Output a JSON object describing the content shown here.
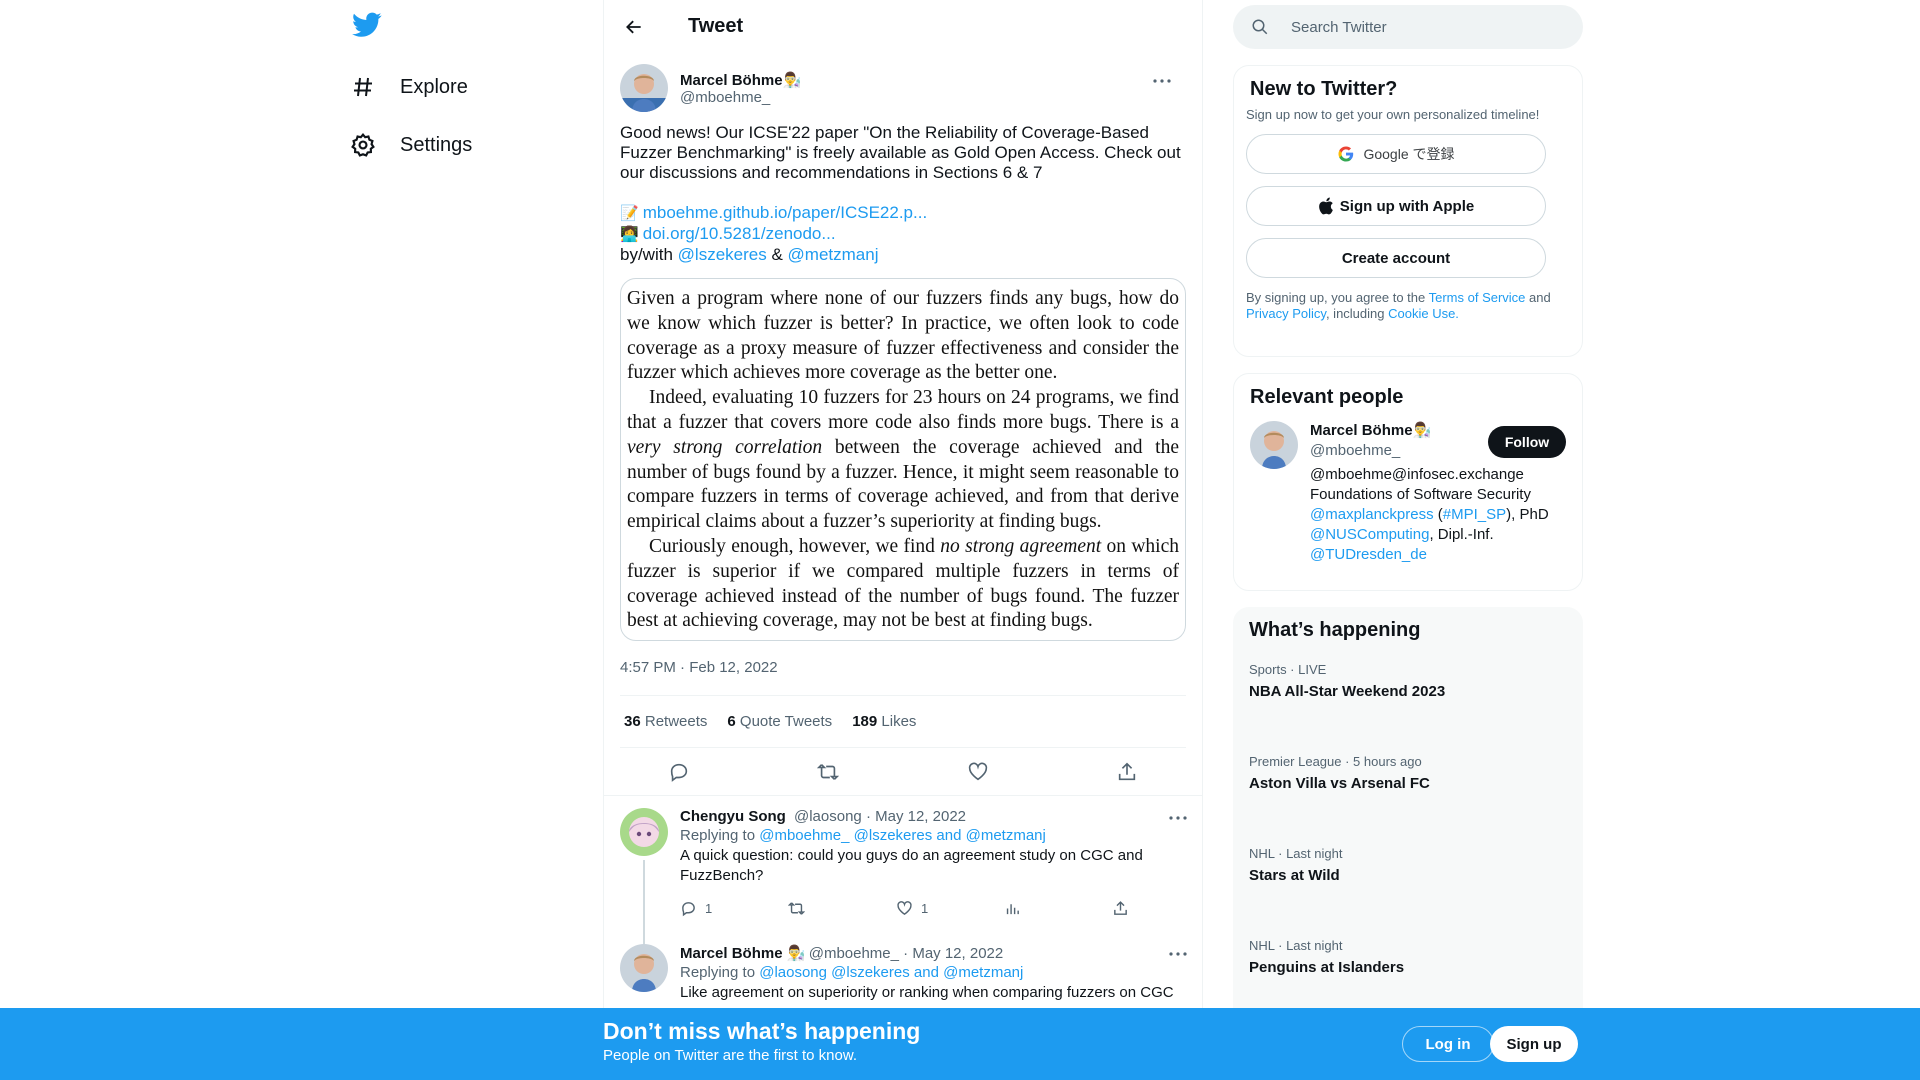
{
  "nav": {
    "items": [
      {
        "label": "Explore",
        "icon": "hashtag-icon"
      },
      {
        "label": "Settings",
        "icon": "gear-icon"
      }
    ]
  },
  "header": {
    "title": "Tweet"
  },
  "tweet": {
    "author_name": "Marcel Böhme",
    "author_emoji": "👨‍🔬",
    "author_handle": "@mboehme_",
    "text": "Good news! Our ICSE'22 paper \"On the Reliability of Coverage-Based Fuzzer Benchmarking\" is freely available as Gold Open Access. Check out our discussions and recommendations in Sections 6 & 7",
    "link1_emoji": "📝",
    "link1": "mboehme.github.io/paper/ICSE22.p...",
    "link2_emoji": "👩‍💻",
    "link2": "doi.org/10.5281/zenodo...",
    "bywith_prefix": "by/with",
    "mention1": "@lszekeres",
    "amp": "&",
    "mention2": "@metzmanj",
    "paper": {
      "p1": "Given a program where none of our fuzzers finds any bugs, how do we know which fuzzer is better? In practice, we often look to code coverage as a proxy measure of fuzzer effectiveness and consider the fuzzer which achieves more coverage as the better one.",
      "p2a": "Indeed, evaluating 10 fuzzers for 23 hours on 24 programs, we find that a fuzzer that covers more code also finds more bugs. There is a ",
      "p2em": "very strong correlation",
      "p2b": " between the coverage achieved and the number of bugs found by a fuzzer. Hence, it might seem reasonable to compare fuzzers in terms of coverage achieved, and from that derive empirical claims about a fuzzer’s superiority at finding bugs.",
      "p3a": "Curiously enough, however, we find ",
      "p3em": "no strong agreement",
      "p3b": " on which fuzzer is superior if we compared multiple fuzzers in terms of coverage achieved instead of the number of bugs found. The fuzzer best at achieving coverage, may not be best at finding bugs."
    },
    "timestamp": "4:57 PM · Feb 12, 2022",
    "stats": {
      "retweets_count": "36",
      "retweets_label": "Retweets",
      "quotes_count": "6",
      "quotes_label": "Quote Tweets",
      "likes_count": "189",
      "likes_label": "Likes"
    }
  },
  "replies": [
    {
      "name": "Chengyu Song",
      "handle": "@laosong",
      "date": "· May 12, 2022",
      "replying_prefix": "Replying to",
      "replying_to": "@mboehme_ @lszekeres and @metzmanj",
      "text": "A quick question: could you guys do an agreement study on CGC and FuzzBench?",
      "reply_count": "1",
      "like_count": "1"
    },
    {
      "name": "Marcel Böhme",
      "emoji": "👨‍🔬",
      "handle": "@mboehme_",
      "date": "· May 12, 2022",
      "replying_prefix": "Replying to",
      "replying_to": "@laosong @lszekeres and @metzmanj",
      "text": "Like agreement on superiority or ranking when comparing fuzzers on CGC"
    }
  ],
  "search": {
    "placeholder": "Search Twitter"
  },
  "new_to_twitter": {
    "title": "New to Twitter?",
    "subtitle": "Sign up now to get your own personalized timeline!",
    "google_btn": "Google で登録",
    "apple_btn": "Sign up with Apple",
    "create_btn": "Create account",
    "legal_pre": "By signing up, you agree to the ",
    "terms": "Terms of Service",
    "and": " and ",
    "privacy": "Privacy Policy",
    "including": ", including ",
    "cookie": "Cookie Use."
  },
  "relevant": {
    "title": "Relevant people",
    "name": "Marcel Böhme",
    "emoji": "👨‍🔬",
    "handle": "@mboehme_",
    "follow": "Follow",
    "bio_line1": "@mboehme@infosec.exchange",
    "bio_line2": "Foundations of Software Security",
    "bio_link1": "@maxplanckpress",
    "bio_paren_open": " (",
    "bio_link2": "#MPI_SP",
    "bio_paren_close": "), PhD",
    "bio_link3": "@NUSComputing",
    "bio_dipl": ", Dipl.-Inf.",
    "bio_link4": "@TUDresden_de"
  },
  "whats_happening": {
    "title": "What’s happening",
    "trends": [
      {
        "meta": "Sports · LIVE",
        "title": "NBA All-Star Weekend 2023"
      },
      {
        "meta": "Premier League · 5 hours ago",
        "title": "Aston Villa vs Arsenal FC"
      },
      {
        "meta": "NHL · Last night",
        "title": "Stars at Wild"
      },
      {
        "meta": "NHL · Last night",
        "title": "Penguins at Islanders"
      }
    ]
  },
  "bottom_bar": {
    "headline": "Don’t miss what’s happening",
    "sub": "People on Twitter are the first to know.",
    "login": "Log in",
    "signup": "Sign up"
  },
  "colors": {
    "accent": "#1d9bf0",
    "text": "#0f1419",
    "muted": "#536471"
  }
}
